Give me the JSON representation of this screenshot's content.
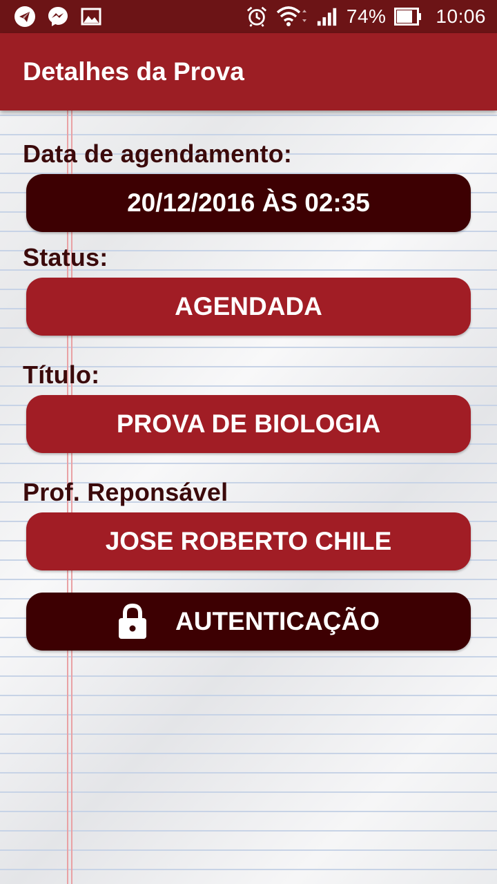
{
  "statusbar": {
    "icons_left": [
      "telegram-icon",
      "messenger-icon",
      "gallery-icon"
    ],
    "icons_right": [
      "alarm-icon",
      "wifi-icon",
      "signal-icon",
      "battery-icon"
    ],
    "battery": "74%",
    "time": "10:06"
  },
  "appbar": {
    "title": "Detalhes da Prova"
  },
  "fields": {
    "date_label": "Data de agendamento:",
    "date_value": "20/12/2016 ÀS 02:35",
    "status_label": "Status:",
    "status_value": "AGENDADA",
    "title_label": "Título:",
    "title_value": "PROVA DE BIOLOGIA",
    "teacher_label": "Prof. Reponsável",
    "teacher_value": "JOSE ROBERTO CHILE"
  },
  "actions": {
    "auth_label": "AUTENTICAÇÃO",
    "auth_icon": "lock-icon"
  },
  "colors": {
    "statusbar": "#6c1416",
    "appbar": "#9c1e24",
    "dark_pill": "#3d0002",
    "red_pill": "#a11d25",
    "label_text": "#3b0a0b"
  }
}
